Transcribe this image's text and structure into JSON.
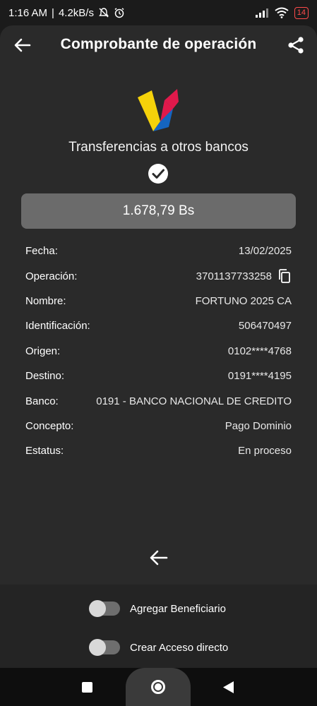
{
  "status_bar": {
    "time": "1:16 AM",
    "speed": "4.2kB/s",
    "battery": "14"
  },
  "header": {
    "title": "Comprobante de operación"
  },
  "receipt": {
    "subtitle": "Transferencias a otros bancos",
    "amount": "1.678,79 Bs",
    "rows": [
      {
        "label": "Fecha:",
        "value": "13/02/2025"
      },
      {
        "label": "Operación:",
        "value": "3701137733258"
      },
      {
        "label": "Nombre:",
        "value": "FORTUNO 2025 CA"
      },
      {
        "label": "Identificación:",
        "value": "506470497"
      },
      {
        "label": "Origen:",
        "value": "0102****4768"
      },
      {
        "label": "Destino:",
        "value": "0191****4195"
      },
      {
        "label": "Banco:",
        "value": "0191 - BANCO NACIONAL DE CREDITO"
      },
      {
        "label": "Concepto:",
        "value": "Pago Dominio"
      },
      {
        "label": "Estatus:",
        "value": "En proceso"
      }
    ]
  },
  "options": {
    "add_beneficiary": "Agregar Beneficiario",
    "create_shortcut": "Crear Acceso directo"
  },
  "colors": {
    "background": "#2a2a2a",
    "amount_box": "#6b6b6b",
    "logo_yellow": "#f5d20a",
    "logo_blue": "#1565c0",
    "logo_red": "#e0194b"
  }
}
